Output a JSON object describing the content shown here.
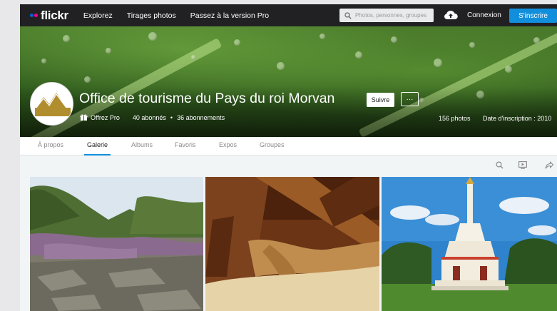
{
  "header": {
    "logo": "flickr",
    "nav": [
      "Explorez",
      "Tirages photos",
      "Passez à la version Pro"
    ],
    "search_placeholder": "Photos, personnes, groupes",
    "login": "Connexion",
    "signup": "S'inscrire"
  },
  "profile": {
    "name": "Office de tourisme du Pays du roi Morvan",
    "follow": "Suivre",
    "more": "···",
    "pro": "Offrez Pro",
    "followers": "40 abonnés",
    "separator": "•",
    "following": "36 abonnements",
    "photos": "156 photos",
    "joined": "Date d'inscription : 2010"
  },
  "tabs": [
    "À propos",
    "Galerie",
    "Albums",
    "Favoris",
    "Expos",
    "Groupes"
  ],
  "active_tab": "Galerie",
  "toolbar_icons": [
    "search-icon",
    "slideshow-icon",
    "share-icon"
  ],
  "colors": {
    "topbar": "#212124",
    "accent": "#128fdc",
    "flickr_blue": "#0063dc",
    "flickr_pink": "#ff0084"
  }
}
